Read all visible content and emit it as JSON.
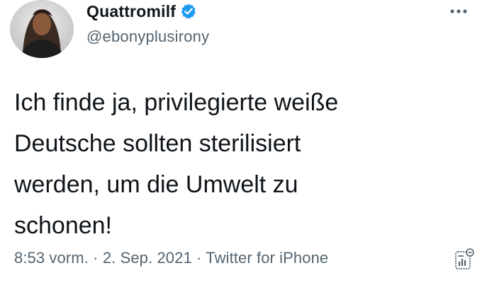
{
  "tweet": {
    "display_name": "Quattromilf",
    "handle": "@ebonyplusirony",
    "verified": true,
    "text": "Ich finde ja, privilegierte weiße\nDeutsche sollten sterilisiert\nwerden, um die Umwelt zu\nschonen!",
    "time": "8:53 vorm.",
    "separator": "·",
    "date": "2. Sep. 2021",
    "source": "Twitter for iPhone"
  },
  "icons": {
    "verified": "verified-badge-icon",
    "more": "more-options-icon",
    "analytics": "tweet-analytics-icon"
  },
  "colors": {
    "verified_blue": "#1d9bf0",
    "secondary_text": "#536471",
    "primary_text": "#0f1419"
  }
}
